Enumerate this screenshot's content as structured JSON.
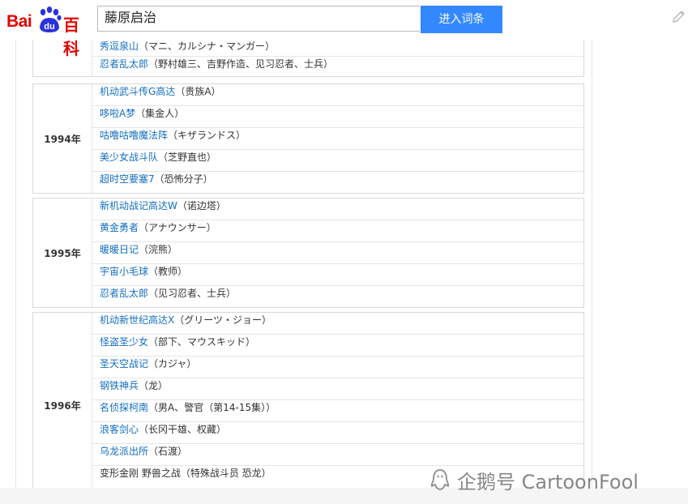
{
  "header": {
    "logo_left": "Bai",
    "logo_paw": "du",
    "logo_right": "百科",
    "search_value": "藤原启治",
    "search_button": "进入词条"
  },
  "partial_top": {
    "rows": [
      {
        "link": "秀逗泉山",
        "role": "（マニ、カルシナ・マンガー）"
      },
      {
        "link": "忍者乱太郎",
        "role": "（野村雄三、吉野作造、见习忍者、士兵）"
      }
    ]
  },
  "groups": [
    {
      "year": "1994年",
      "rows": [
        {
          "link": "机动武斗传G高达",
          "role": "（贵族A）"
        },
        {
          "link": "哆啦A梦",
          "role": "（集金人）"
        },
        {
          "link": "咕噜咕噜魔法阵",
          "role": "（キザランドス）"
        },
        {
          "link": "美少女战斗队",
          "role": "（芝野直也）"
        },
        {
          "link": "超时空要塞7",
          "role": "（恐怖分子）"
        }
      ]
    },
    {
      "year": "1995年",
      "rows": [
        {
          "link": "新机动战记高达W",
          "role": "（诺边塔）"
        },
        {
          "link": "黄金勇者",
          "role": "（アナウンサー）"
        },
        {
          "link": "暖暖日记",
          "role": "（浣熊）"
        },
        {
          "link": "宇宙小毛球",
          "role": "（教师）"
        },
        {
          "link": "忍者乱太郎",
          "role": "（见习忍者、士兵）"
        }
      ]
    },
    {
      "year": "1996年",
      "rows": [
        {
          "link": "机动新世纪高达X",
          "role": "（グリーツ・ジョー）"
        },
        {
          "link": "怪盗圣少女",
          "role": "（部下、マウスキッド）"
        },
        {
          "link": "圣天空战记",
          "role": "（カジャ）"
        },
        {
          "link": "钢铁神兵",
          "role": "（龙）"
        },
        {
          "link": "名侦探柯南",
          "role": "（男A、警官（第14-15集））"
        },
        {
          "link": "浪客剑心",
          "role": "（长冈干雄、权藏）"
        },
        {
          "link": "乌龙派出所",
          "role": "（石渡）"
        },
        {
          "link": "",
          "role": "变形金刚 野兽之战（特殊战斗员 恐龙）"
        }
      ]
    }
  ],
  "watermark": {
    "text": "企鹅号 CartoonFool"
  },
  "colors": {
    "link": "#136ec2",
    "brand_red": "#e10602",
    "button_blue": "#3388ff"
  }
}
